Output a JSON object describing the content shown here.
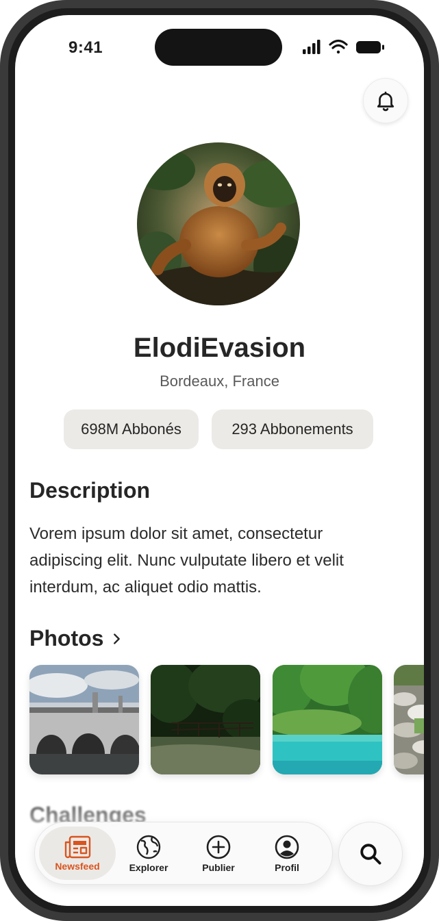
{
  "status_bar": {
    "time": "9:41"
  },
  "profile": {
    "username": "ElodiEvasion",
    "location": "Bordeaux, France",
    "followers": "698M Abbonés",
    "following": "293 Abbonements"
  },
  "description": {
    "title": "Description",
    "text": "Vorem ipsum dolor sit amet, consectetur adipiscing elit. Nunc vulputate libero et velit interdum, ac aliquet odio mattis."
  },
  "photos": {
    "title": "Photos",
    "items": [
      "bridge-photo",
      "forest-photo",
      "lake-photo",
      "river-photo"
    ]
  },
  "challenges": {
    "title": "Challenges"
  },
  "nav": {
    "items": [
      {
        "label": "Newsfeed",
        "icon": "newspaper-icon",
        "active": true
      },
      {
        "label": "Explorer",
        "icon": "globe-icon",
        "active": false
      },
      {
        "label": "Publier",
        "icon": "plus-circle-icon",
        "active": false
      },
      {
        "label": "Profil",
        "icon": "user-circle-icon",
        "active": false
      }
    ],
    "search_icon": "search-icon"
  },
  "colors": {
    "accent": "#d9541e",
    "chip_bg": "#eceae6",
    "text": "#262626"
  }
}
